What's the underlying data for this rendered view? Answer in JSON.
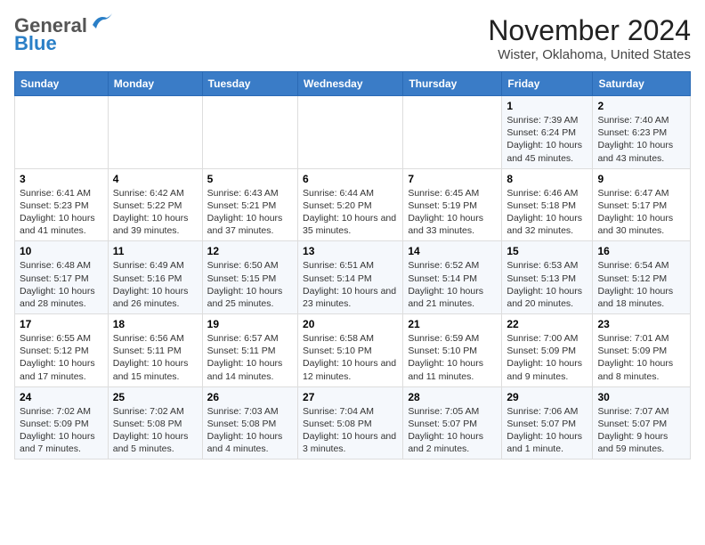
{
  "header": {
    "logo_general": "General",
    "logo_blue": "Blue",
    "title": "November 2024",
    "subtitle": "Wister, Oklahoma, United States"
  },
  "days_of_week": [
    "Sunday",
    "Monday",
    "Tuesday",
    "Wednesday",
    "Thursday",
    "Friday",
    "Saturday"
  ],
  "weeks": [
    [
      {
        "day": "",
        "detail": ""
      },
      {
        "day": "",
        "detail": ""
      },
      {
        "day": "",
        "detail": ""
      },
      {
        "day": "",
        "detail": ""
      },
      {
        "day": "",
        "detail": ""
      },
      {
        "day": "1",
        "detail": "Sunrise: 7:39 AM\nSunset: 6:24 PM\nDaylight: 10 hours and 45 minutes."
      },
      {
        "day": "2",
        "detail": "Sunrise: 7:40 AM\nSunset: 6:23 PM\nDaylight: 10 hours and 43 minutes."
      }
    ],
    [
      {
        "day": "3",
        "detail": "Sunrise: 6:41 AM\nSunset: 5:23 PM\nDaylight: 10 hours and 41 minutes."
      },
      {
        "day": "4",
        "detail": "Sunrise: 6:42 AM\nSunset: 5:22 PM\nDaylight: 10 hours and 39 minutes."
      },
      {
        "day": "5",
        "detail": "Sunrise: 6:43 AM\nSunset: 5:21 PM\nDaylight: 10 hours and 37 minutes."
      },
      {
        "day": "6",
        "detail": "Sunrise: 6:44 AM\nSunset: 5:20 PM\nDaylight: 10 hours and 35 minutes."
      },
      {
        "day": "7",
        "detail": "Sunrise: 6:45 AM\nSunset: 5:19 PM\nDaylight: 10 hours and 33 minutes."
      },
      {
        "day": "8",
        "detail": "Sunrise: 6:46 AM\nSunset: 5:18 PM\nDaylight: 10 hours and 32 minutes."
      },
      {
        "day": "9",
        "detail": "Sunrise: 6:47 AM\nSunset: 5:17 PM\nDaylight: 10 hours and 30 minutes."
      }
    ],
    [
      {
        "day": "10",
        "detail": "Sunrise: 6:48 AM\nSunset: 5:17 PM\nDaylight: 10 hours and 28 minutes."
      },
      {
        "day": "11",
        "detail": "Sunrise: 6:49 AM\nSunset: 5:16 PM\nDaylight: 10 hours and 26 minutes."
      },
      {
        "day": "12",
        "detail": "Sunrise: 6:50 AM\nSunset: 5:15 PM\nDaylight: 10 hours and 25 minutes."
      },
      {
        "day": "13",
        "detail": "Sunrise: 6:51 AM\nSunset: 5:14 PM\nDaylight: 10 hours and 23 minutes."
      },
      {
        "day": "14",
        "detail": "Sunrise: 6:52 AM\nSunset: 5:14 PM\nDaylight: 10 hours and 21 minutes."
      },
      {
        "day": "15",
        "detail": "Sunrise: 6:53 AM\nSunset: 5:13 PM\nDaylight: 10 hours and 20 minutes."
      },
      {
        "day": "16",
        "detail": "Sunrise: 6:54 AM\nSunset: 5:12 PM\nDaylight: 10 hours and 18 minutes."
      }
    ],
    [
      {
        "day": "17",
        "detail": "Sunrise: 6:55 AM\nSunset: 5:12 PM\nDaylight: 10 hours and 17 minutes."
      },
      {
        "day": "18",
        "detail": "Sunrise: 6:56 AM\nSunset: 5:11 PM\nDaylight: 10 hours and 15 minutes."
      },
      {
        "day": "19",
        "detail": "Sunrise: 6:57 AM\nSunset: 5:11 PM\nDaylight: 10 hours and 14 minutes."
      },
      {
        "day": "20",
        "detail": "Sunrise: 6:58 AM\nSunset: 5:10 PM\nDaylight: 10 hours and 12 minutes."
      },
      {
        "day": "21",
        "detail": "Sunrise: 6:59 AM\nSunset: 5:10 PM\nDaylight: 10 hours and 11 minutes."
      },
      {
        "day": "22",
        "detail": "Sunrise: 7:00 AM\nSunset: 5:09 PM\nDaylight: 10 hours and 9 minutes."
      },
      {
        "day": "23",
        "detail": "Sunrise: 7:01 AM\nSunset: 5:09 PM\nDaylight: 10 hours and 8 minutes."
      }
    ],
    [
      {
        "day": "24",
        "detail": "Sunrise: 7:02 AM\nSunset: 5:09 PM\nDaylight: 10 hours and 7 minutes."
      },
      {
        "day": "25",
        "detail": "Sunrise: 7:02 AM\nSunset: 5:08 PM\nDaylight: 10 hours and 5 minutes."
      },
      {
        "day": "26",
        "detail": "Sunrise: 7:03 AM\nSunset: 5:08 PM\nDaylight: 10 hours and 4 minutes."
      },
      {
        "day": "27",
        "detail": "Sunrise: 7:04 AM\nSunset: 5:08 PM\nDaylight: 10 hours and 3 minutes."
      },
      {
        "day": "28",
        "detail": "Sunrise: 7:05 AM\nSunset: 5:07 PM\nDaylight: 10 hours and 2 minutes."
      },
      {
        "day": "29",
        "detail": "Sunrise: 7:06 AM\nSunset: 5:07 PM\nDaylight: 10 hours and 1 minute."
      },
      {
        "day": "30",
        "detail": "Sunrise: 7:07 AM\nSunset: 5:07 PM\nDaylight: 9 hours and 59 minutes."
      }
    ]
  ]
}
